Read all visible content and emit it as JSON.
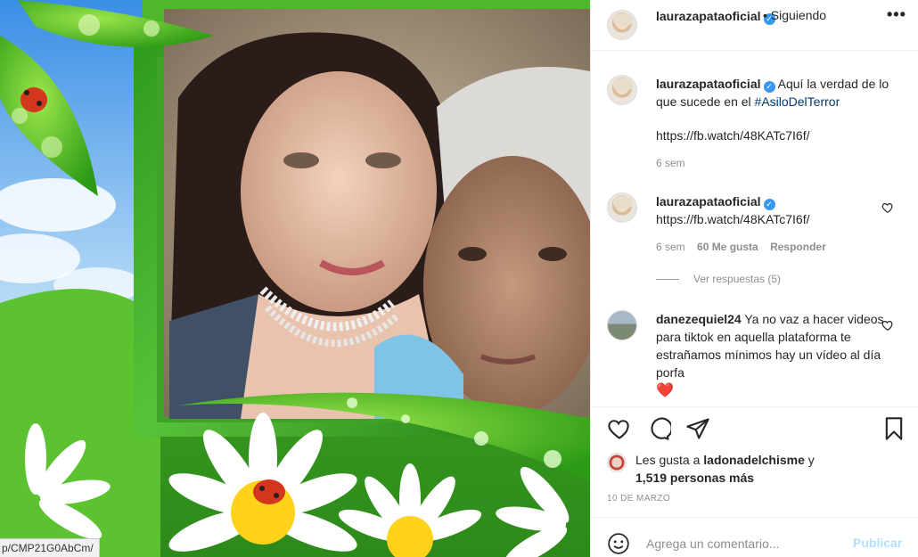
{
  "post": {
    "tooltip_url": "p/CMP21G0AbCm/"
  },
  "header": {
    "username": "laurazapataoficial",
    "follow_status": "• Siguiendo",
    "more_icon": "more-icon"
  },
  "caption": {
    "username": "laurazapataoficial",
    "text": "Aquí la verdad de lo que sucede en el",
    "hashtag": "#AsiloDelTerror",
    "link": "https://fb.watch/48KATc7I6f/",
    "time": "6 sem"
  },
  "comments": [
    {
      "username": "laurazapataoficial",
      "text": "https://fb.watch/48KATc7I6f/",
      "time": "6 sem",
      "likes": "60 Me gusta",
      "reply": "Responder",
      "view_replies": "Ver respuestas (5)"
    },
    {
      "username": "danezequiel24",
      "text": "Ya no vaz a hacer videos para tiktok en aquella plataforma te estrañamos mínimos hay un vídeo al día porfa",
      "emoji": "❤️"
    }
  ],
  "likes": {
    "prefix": "Les gusta a",
    "user": "ladonadelchisme",
    "conj": "y",
    "others": "1,519 personas más"
  },
  "date": "10 DE MARZO",
  "composer": {
    "placeholder": "Agrega un comentario...",
    "publish": "Publicar"
  },
  "colors": {
    "link": "#00376b",
    "verified": "#3897f0",
    "publish_disabled": "#b2dffc",
    "heart_red": "#ed4956"
  }
}
